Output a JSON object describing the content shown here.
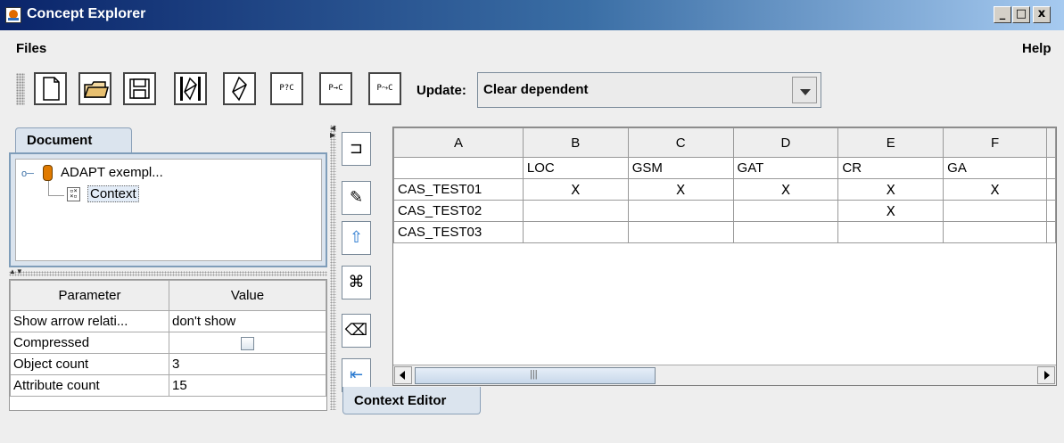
{
  "window": {
    "title": "Concept Explorer"
  },
  "titlebar_buttons": {
    "minimize": "_",
    "maximize": "□",
    "close": "x"
  },
  "menu": {
    "files": "Files",
    "help": "Help"
  },
  "toolbar": {
    "buttons": [
      {
        "name": "new-document-icon"
      },
      {
        "name": "open-folder-icon"
      },
      {
        "name": "save-disk-icon"
      },
      {
        "name": "lattice-build-icon"
      },
      {
        "name": "lattice-icon"
      },
      {
        "name": "p-query-c",
        "text": "P?C"
      },
      {
        "name": "p-arrow-c",
        "text": "P→C"
      },
      {
        "name": "p-arrow-c-alt",
        "text": "P⤳C"
      }
    ],
    "update_label": "Update:",
    "update_value": "Clear dependent"
  },
  "document_tab": {
    "label": "Document"
  },
  "tree": {
    "root": "ADAPT exempl...",
    "child": "Context"
  },
  "params": {
    "header_parameter": "Parameter",
    "header_value": "Value",
    "rows": [
      {
        "name": "Show arrow relati...",
        "value": "don't show"
      },
      {
        "name": "Compressed",
        "value": ""
      },
      {
        "name": "Object count",
        "value": "3"
      },
      {
        "name": "Attribute count",
        "value": "15"
      }
    ]
  },
  "grid": {
    "columns": [
      "A",
      "B",
      "C",
      "D",
      "E",
      "F"
    ],
    "attributes": [
      "",
      "LOC",
      "GSM",
      "GAT",
      "CR",
      "GA"
    ],
    "objects": [
      {
        "name": "CAS_TEST01",
        "cells": [
          "X",
          "X",
          "X",
          "X",
          "X"
        ]
      },
      {
        "name": "CAS_TEST02",
        "cells": [
          "",
          "",
          "",
          "X",
          ""
        ]
      },
      {
        "name": "CAS_TEST03",
        "cells": [
          "",
          "",
          "",
          "",
          ""
        ]
      }
    ],
    "scroll_grip": "|||"
  },
  "context_tab": {
    "label": "Context Editor"
  }
}
